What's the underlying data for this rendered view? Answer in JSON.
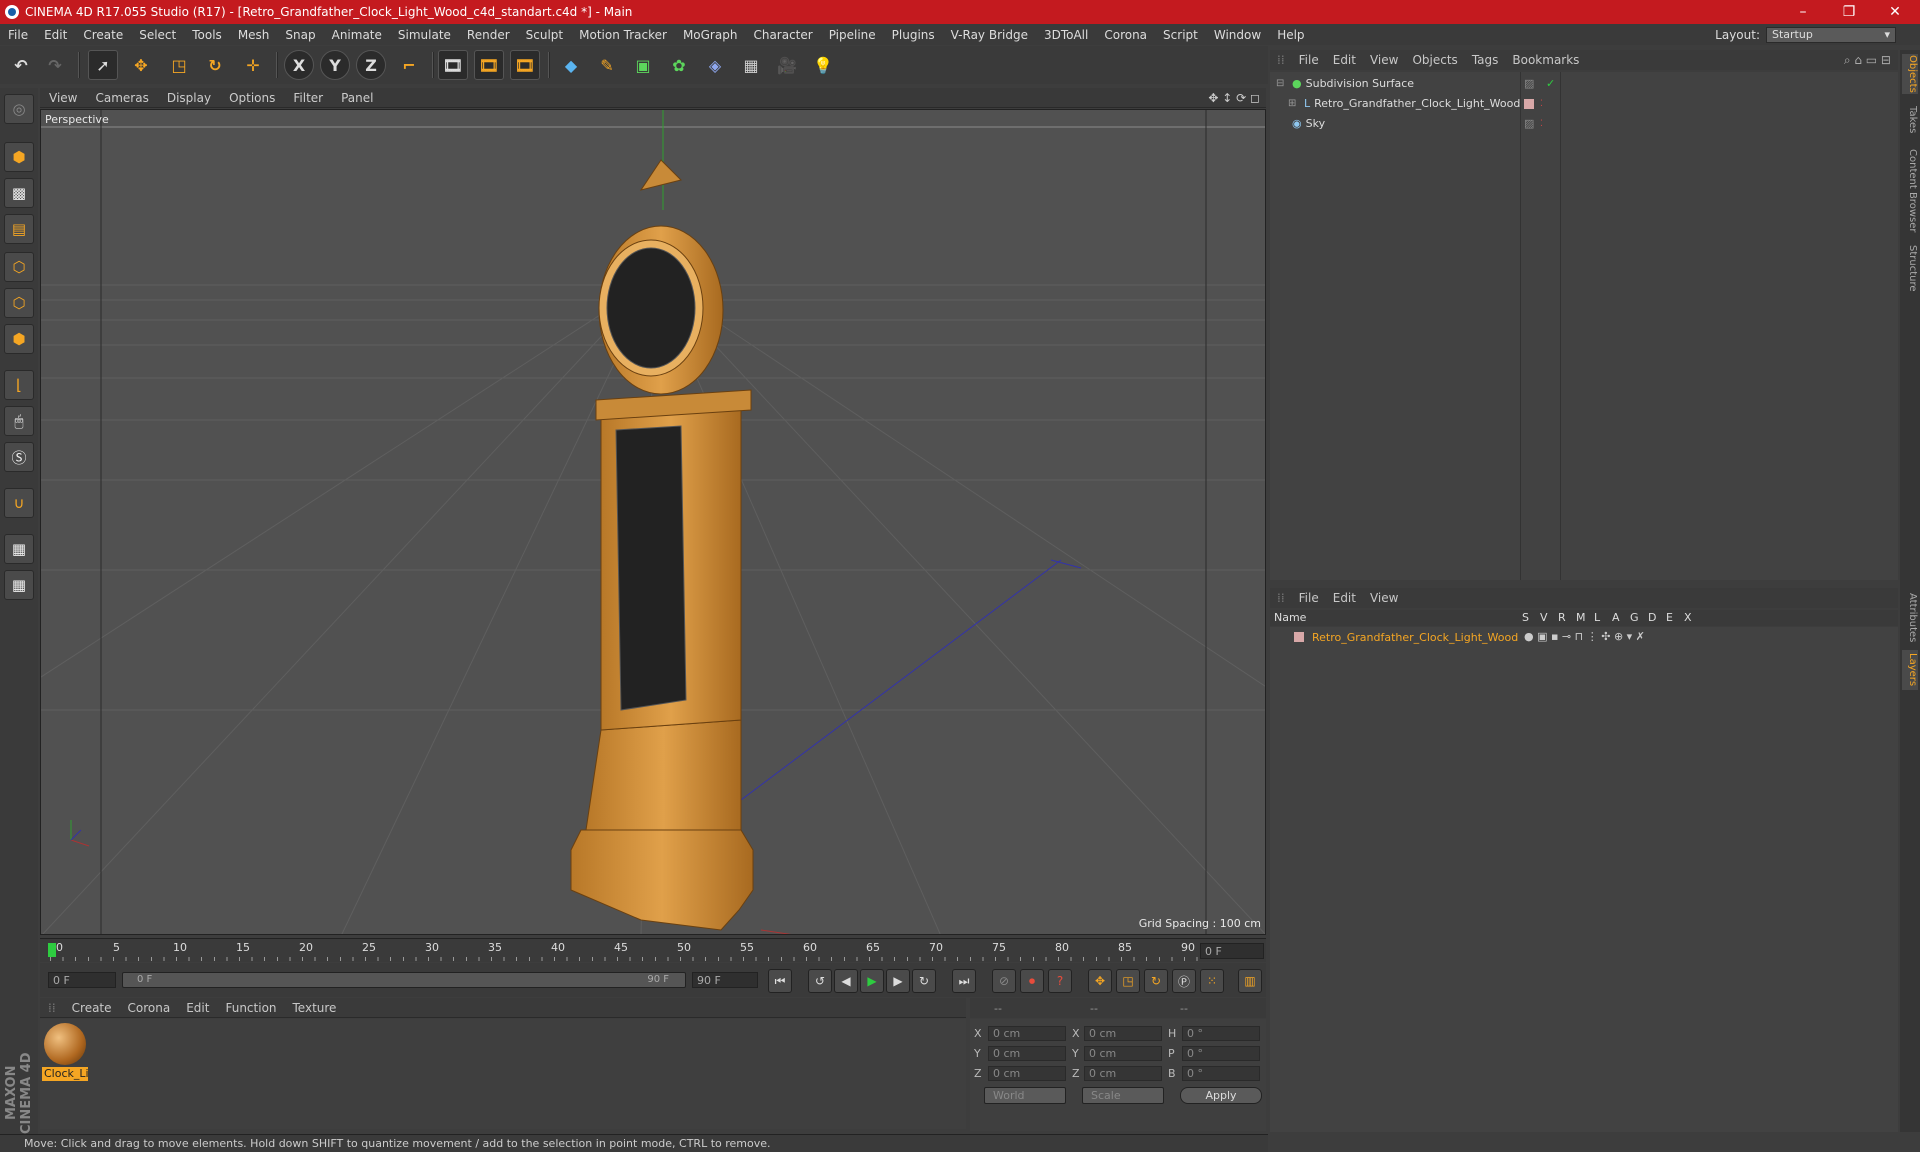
{
  "titlebar": {
    "title": "CINEMA 4D R17.055 Studio (R17) - [Retro_Grandfather_Clock_Light_Wood_c4d_standart.c4d *] - Main",
    "minimize": "–",
    "maximize": "❐",
    "close": "✕"
  },
  "menubar": {
    "items": [
      "File",
      "Edit",
      "Create",
      "Select",
      "Tools",
      "Mesh",
      "Snap",
      "Animate",
      "Simulate",
      "Render",
      "Sculpt",
      "Motion Tracker",
      "MoGraph",
      "Character",
      "Pipeline",
      "Plugins",
      "V-Ray Bridge",
      "3DToAll",
      "Corona",
      "Script",
      "Window",
      "Help"
    ],
    "layout_label": "Layout:",
    "layout_value": "Startup"
  },
  "toolbar": {
    "x": "X",
    "y": "Y",
    "z": "Z"
  },
  "viewport": {
    "menu": [
      "View",
      "Cameras",
      "Display",
      "Options",
      "Filter",
      "Panel"
    ],
    "label": "Perspective",
    "grid_spacing": "Grid Spacing : 100 cm"
  },
  "timeline": {
    "ticks": [
      "0",
      "5",
      "10",
      "15",
      "20",
      "25",
      "30",
      "35",
      "40",
      "45",
      "50",
      "55",
      "60",
      "65",
      "70",
      "75",
      "80",
      "85",
      "90"
    ],
    "end_field": "0 F",
    "start": "0 F",
    "slider_start": "0 F",
    "slider_end": "90 F",
    "end": "90 F"
  },
  "material": {
    "menu": [
      "Create",
      "Corona",
      "Edit",
      "Function",
      "Texture"
    ],
    "name": "Clock_Li"
  },
  "coords": {
    "header": [
      "--",
      "--",
      "--"
    ],
    "rows": [
      {
        "a": "X",
        "av": "0 cm",
        "b": "X",
        "bv": "0 cm",
        "c": "H",
        "cv": "0 °"
      },
      {
        "a": "Y",
        "av": "0 cm",
        "b": "Y",
        "bv": "0 cm",
        "c": "P",
        "cv": "0 °"
      },
      {
        "a": "Z",
        "av": "0 cm",
        "b": "Z",
        "bv": "0 cm",
        "c": "B",
        "cv": "0 °"
      }
    ],
    "world": "World",
    "scale": "Scale",
    "apply": "Apply"
  },
  "status": "Move: Click and drag to move elements. Hold down SHIFT to quantize movement / add to the selection in point mode, CTRL to remove.",
  "objects": {
    "menu": [
      "File",
      "Edit",
      "View",
      "Objects",
      "Tags",
      "Bookmarks"
    ],
    "items": [
      "Subdivision Surface",
      "Retro_Grandfather_Clock_Light_Wood",
      "Sky"
    ]
  },
  "layers": {
    "menu": [
      "File",
      "Edit",
      "View"
    ],
    "cols": [
      "Name",
      "S",
      "V",
      "R",
      "M",
      "L",
      "A",
      "G",
      "D",
      "E",
      "X"
    ],
    "item": "Retro_Grandfather_Clock_Light_Wood"
  },
  "sidetabs": [
    "Objects",
    "Takes",
    "Content Browser",
    "Structure",
    "Attributes",
    "Layers"
  ],
  "colors": {
    "accent": "#f5a623",
    "titlebar": "#c41a1f"
  }
}
